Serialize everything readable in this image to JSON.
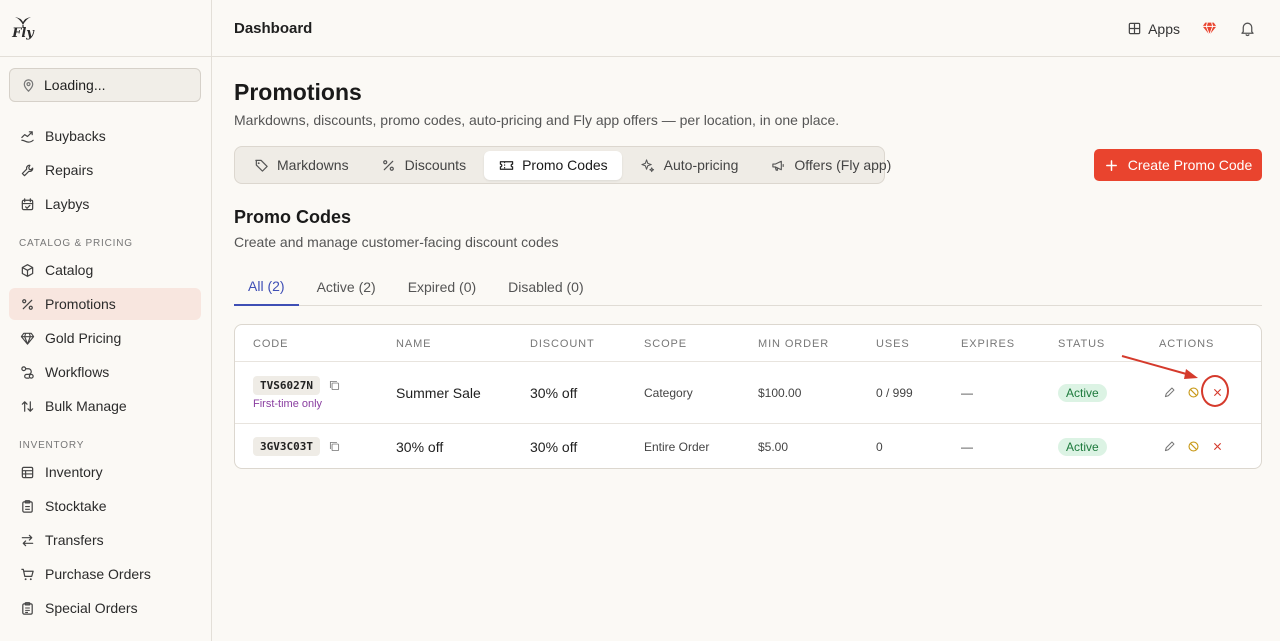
{
  "brand": {
    "logo_text": "Fly"
  },
  "location": {
    "label": "Loading..."
  },
  "sidebar": {
    "items_top": [
      {
        "label": "Buybacks",
        "icon": "buybacks-icon"
      },
      {
        "label": "Repairs",
        "icon": "wrench-icon"
      },
      {
        "label": "Laybys",
        "icon": "calendar-check-icon"
      }
    ],
    "section_catalog": "CATALOG & PRICING",
    "items_catalog": [
      {
        "label": "Catalog",
        "icon": "box-icon"
      },
      {
        "label": "Promotions",
        "icon": "percent-icon",
        "active": true
      },
      {
        "label": "Gold Pricing",
        "icon": "gem-icon"
      },
      {
        "label": "Workflows",
        "icon": "workflow-icon"
      },
      {
        "label": "Bulk Manage",
        "icon": "sort-arrows-icon"
      }
    ],
    "section_inventory": "INVENTORY",
    "items_inventory": [
      {
        "label": "Inventory",
        "icon": "inventory-icon"
      },
      {
        "label": "Stocktake",
        "icon": "clipboard-icon"
      },
      {
        "label": "Transfers",
        "icon": "transfer-icon"
      },
      {
        "label": "Purchase Orders",
        "icon": "cart-icon"
      },
      {
        "label": "Special Orders",
        "icon": "clipboard-list-icon"
      }
    ]
  },
  "header": {
    "title": "Dashboard",
    "apps_label": "Apps"
  },
  "page": {
    "title": "Promotions",
    "subtitle": "Markdowns, discounts, promo codes, auto-pricing and Fly app offers — per location, in one place.",
    "tabs": [
      {
        "label": "Markdowns",
        "icon": "tag-icon"
      },
      {
        "label": "Discounts",
        "icon": "percent-icon"
      },
      {
        "label": "Promo Codes",
        "icon": "ticket-icon",
        "active": true
      },
      {
        "label": "Auto-pricing",
        "icon": "sparkle-icon"
      },
      {
        "label": "Offers (Fly app)",
        "icon": "megaphone-icon"
      }
    ],
    "create_button": "Create Promo Code"
  },
  "promo": {
    "title": "Promo Codes",
    "subtitle": "Create and manage customer-facing discount codes",
    "filters": [
      {
        "label": "All (2)",
        "active": true
      },
      {
        "label": "Active (2)"
      },
      {
        "label": "Expired (0)"
      },
      {
        "label": "Disabled (0)"
      }
    ],
    "columns": [
      "CODE",
      "NAME",
      "DISCOUNT",
      "SCOPE",
      "MIN ORDER",
      "USES",
      "EXPIRES",
      "STATUS",
      "ACTIONS"
    ],
    "rows": [
      {
        "code": "TVS6027N",
        "note": "First-time only",
        "name": "Summer Sale",
        "discount": "30% off",
        "scope": "Category",
        "min_order": "$100.00",
        "uses": "0 / 999",
        "expires": "—",
        "status": "Active"
      },
      {
        "code": "3GV3C03T",
        "note": "",
        "name": "30% off",
        "discount": "30% off",
        "scope": "Entire Order",
        "min_order": "$5.00",
        "uses": "0",
        "expires": "—",
        "status": "Active"
      }
    ]
  },
  "colors": {
    "accent": "#e9442e",
    "tab_active": "#3f4fb5",
    "status_active_bg": "#dcf3e4",
    "status_active_fg": "#1d7a3c",
    "annotation": "#d53a2c"
  }
}
